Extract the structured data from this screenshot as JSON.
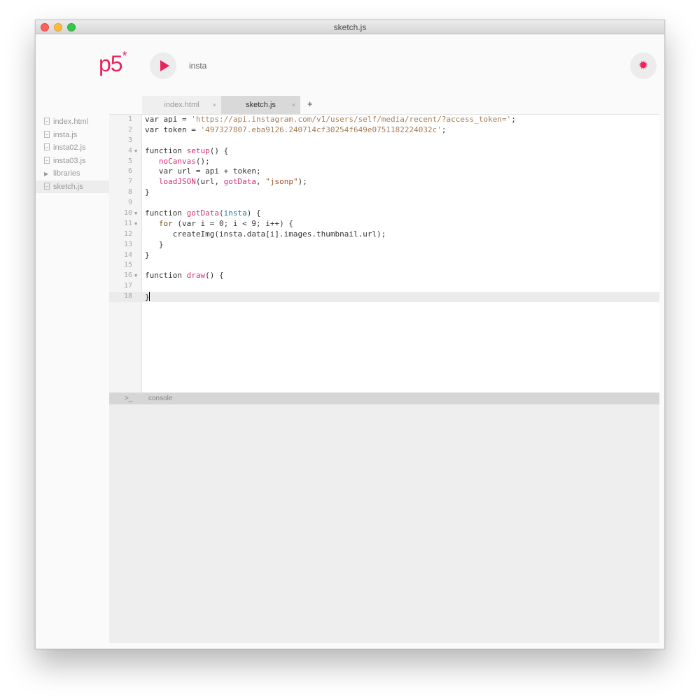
{
  "window": {
    "title": "sketch.js"
  },
  "toolbar": {
    "logo": "p5",
    "logo_star": "*",
    "project_name": "insta",
    "accent_color": "#ed225d"
  },
  "tabs": [
    {
      "label": "index.html",
      "close": "×"
    },
    {
      "label": "sketch.js",
      "close": "×"
    }
  ],
  "tab_add": "+",
  "sidebar": {
    "items": [
      {
        "label": "index.html",
        "icon": "file-icon"
      },
      {
        "label": "insta.js",
        "icon": "file-icon"
      },
      {
        "label": "insta02.js",
        "icon": "file-icon"
      },
      {
        "label": "insta03.js",
        "icon": "file-icon"
      },
      {
        "label": "libraries",
        "icon": "folder-triangle-icon"
      },
      {
        "label": "sketch.js",
        "icon": "file-icon",
        "active": true
      }
    ]
  },
  "editor": {
    "current_line": 18,
    "lines": [
      {
        "n": "1",
        "text": "var api = 'https://api.instagram.com/v1/users/self/media/recent/?access_token=';"
      },
      {
        "n": "2",
        "text": "var token = '497327807.eba9126.240714cf30254f649e0751182224032c';"
      },
      {
        "n": "3",
        "text": ""
      },
      {
        "n": "4",
        "text": "function setup() {",
        "fold": true
      },
      {
        "n": "5",
        "text": "   noCanvas();"
      },
      {
        "n": "6",
        "text": "   var url = api + token;"
      },
      {
        "n": "7",
        "text": "   loadJSON(url, gotData, \"jsonp\");"
      },
      {
        "n": "8",
        "text": "}"
      },
      {
        "n": "9",
        "text": ""
      },
      {
        "n": "10",
        "text": "function gotData(insta) {",
        "fold": true
      },
      {
        "n": "11",
        "text": "   for (var i = 0; i < 9; i++) {",
        "fold": true
      },
      {
        "n": "12",
        "text": "      createImg(insta.data[i].images.thumbnail.url);"
      },
      {
        "n": "13",
        "text": "   }"
      },
      {
        "n": "14",
        "text": "}"
      },
      {
        "n": "15",
        "text": ""
      },
      {
        "n": "16",
        "text": "function draw() {",
        "fold": true
      },
      {
        "n": "17",
        "text": ""
      },
      {
        "n": "18",
        "text": "}"
      }
    ]
  },
  "console": {
    "prompt": ">_",
    "label": "console"
  }
}
